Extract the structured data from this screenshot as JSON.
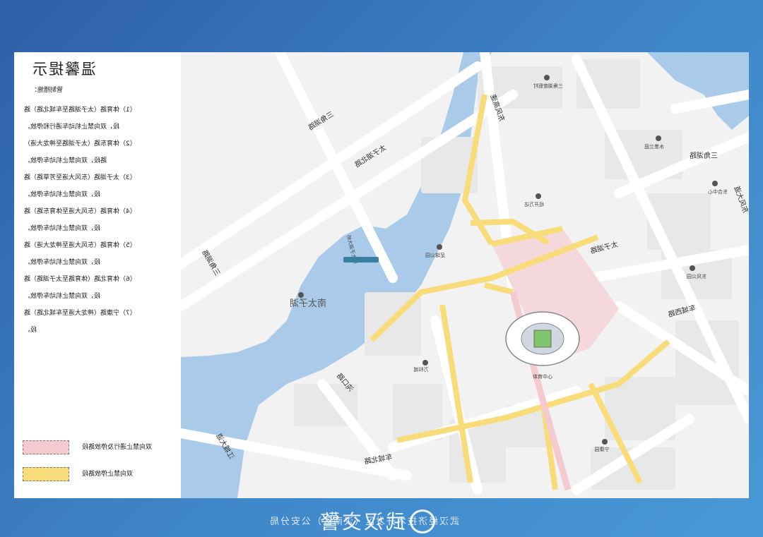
{
  "notice": {
    "title": "温馨提示",
    "subtitle": "管制措施：",
    "rules": [
      "（1）体育路（太子湖路至车城北路）路",
      "段，双向禁止机动车通行和停放。",
      "（2）体育东路（太子湖路至神龙大道）",
      "路段，双向禁止机动车停放。",
      "（3）太子湖路（东风大道至芳草路）路",
      "段，双向禁止机动车停放。",
      "（4）体育路（东风大道至体育东路）路",
      "段，双向禁止机动车停放。",
      "（5）体育路（东风大道至神龙大道）路",
      "段，双向禁止机动车停放。",
      "（6）体育北路（体育路至太子湖路）路",
      "段，双向禁止机动车停放。",
      "（7）宁康路（神龙大道至车城北路）路",
      "段。"
    ]
  },
  "legend": {
    "pink_label": "双向禁止通行及停放路段",
    "yellow_label": "双向禁止停放路段",
    "pink_color": "#f4c9d0",
    "yellow_color": "#f8dc7a"
  },
  "map": {
    "colors": {
      "water": "#a9cbe9",
      "road": "#ffffff",
      "block": "#e8e8e8",
      "stadium": "#f4d8dc",
      "yellow": "#f8dc7a",
      "pink": "#f4c9d0"
    },
    "labels": {
      "road_sanjiaohu_w": "三角湖路",
      "road_taizihu_n": "太子湖北路",
      "road_dongfeng_gaosu": "东风高速",
      "road_sanjiaohu_e": "三角湖路",
      "road_dongfeng_e": "东风大道",
      "road_checheng_xi": "车城西路",
      "road_checheng_bei": "车城北路",
      "road_taizi_1": "太子湖路",
      "road_jingkai": "沌口路",
      "road_sanjiaohu_left": "三角湖路",
      "road_zhuankou": "江城大道",
      "lake": "南太子湖",
      "bridge": "南太子湖大桥",
      "poi_stadium": "体育中心",
      "poi_sanjiao_park": "三角湖度假村",
      "poi_shui": "水墨兰庭",
      "poi_park": "足球公园",
      "poi_dongfeng_park": "东风公园",
      "poi_ningkang": "宁康园",
      "poi_shiji": "万科城",
      "poi_taizi_park": "经开万达",
      "poi_zhongyang": "东合中心"
    }
  },
  "footer": {
    "text": "武汉经济技术开发区（汉南区）公安分局",
    "watermark": "武汉交警"
  }
}
